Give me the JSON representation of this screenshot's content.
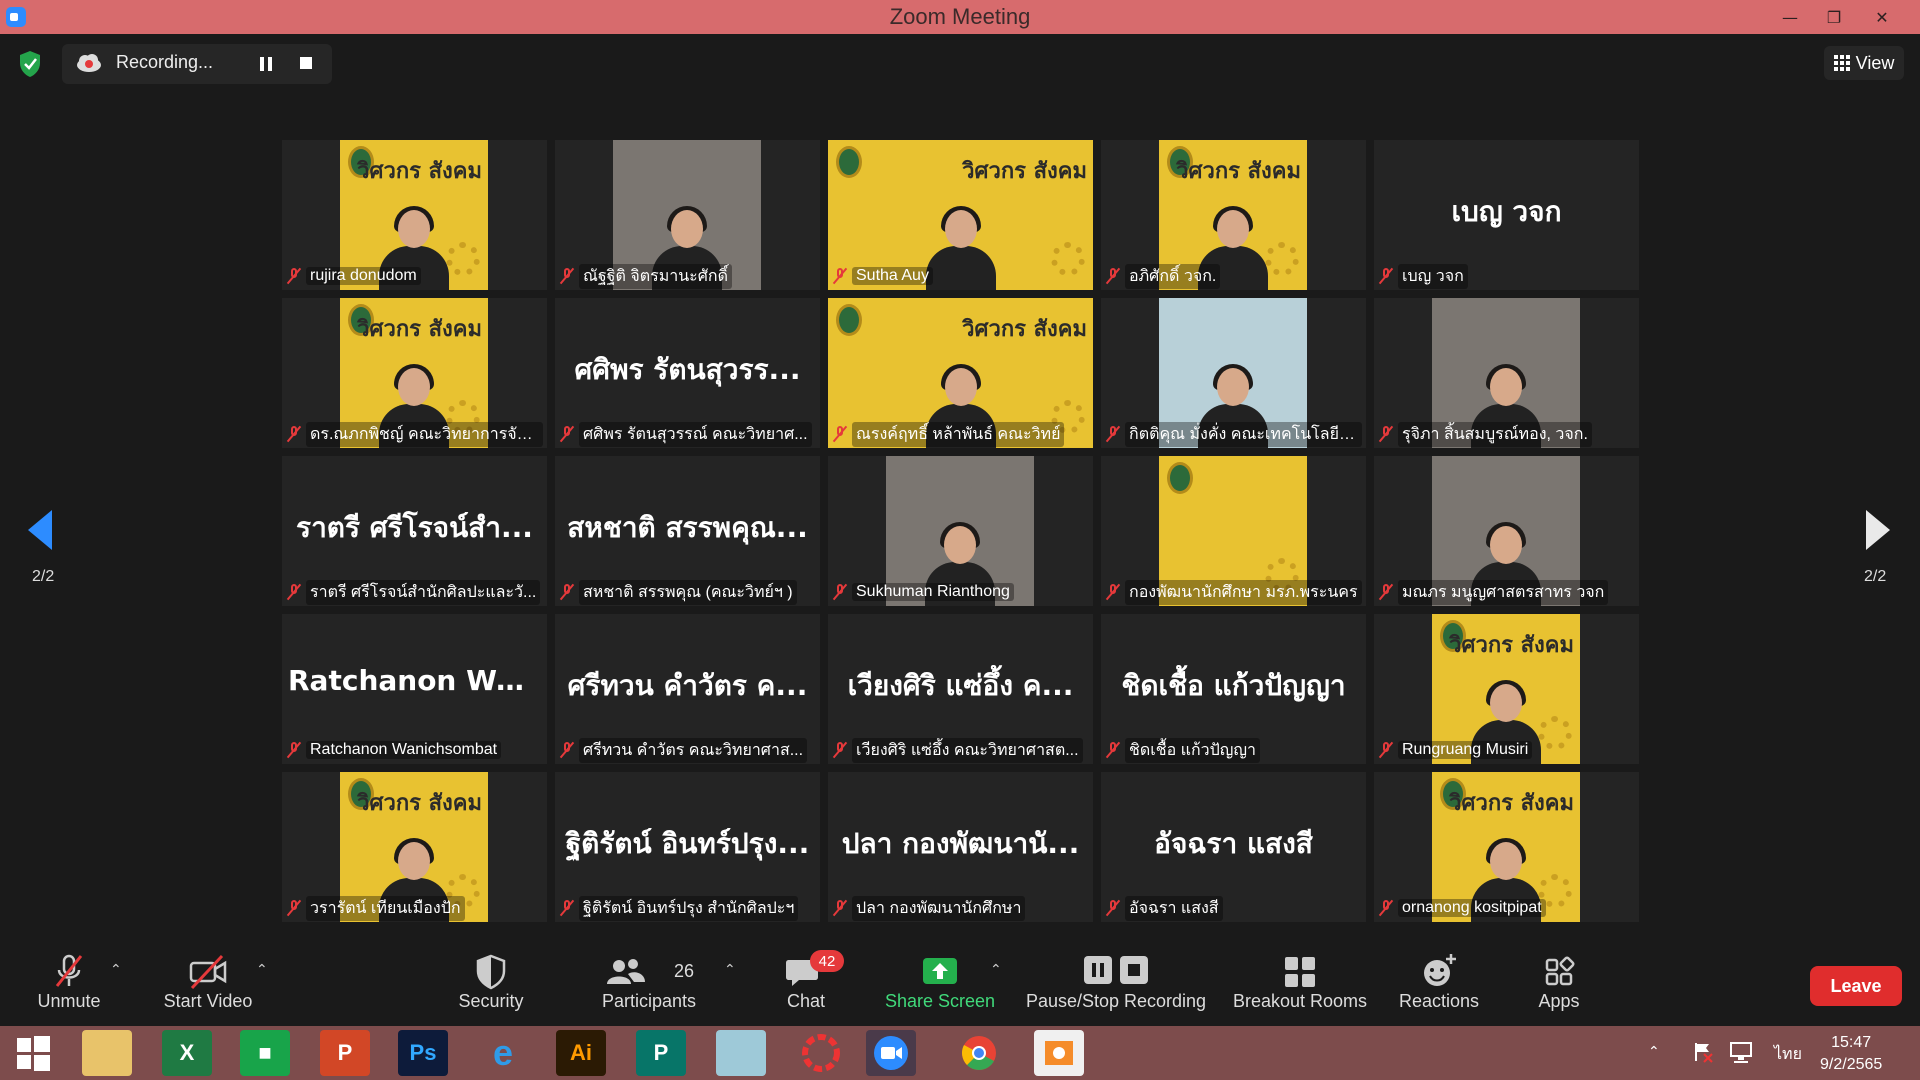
{
  "window": {
    "title": "Zoom Meeting"
  },
  "recording": {
    "status": "Recording..."
  },
  "view": {
    "label": "View"
  },
  "pagination": {
    "left": "2/2",
    "right": "2/2"
  },
  "tiles": [
    {
      "name": "rujira donudom",
      "kind": "poster"
    },
    {
      "name": "ณัฐฐิติ จิตรมานะศักดิ์",
      "kind": "cam"
    },
    {
      "name": "Sutha Auy",
      "kind": "posterfull"
    },
    {
      "name": "อภิศักดิ์ วจก.",
      "kind": "poster"
    },
    {
      "name": "เบญ วจก",
      "kind": "text",
      "display": "เบญ วจก"
    },
    {
      "name": "ดร.ณภกพิชญ์ คณะวิทยาการจัด...",
      "kind": "poster"
    },
    {
      "name": "ศศิพร รัตนสุวรรณ์ คณะวิทยาศ...",
      "kind": "text",
      "display": "ศศิพร รัตนสุวรร..."
    },
    {
      "name": "ณรงค์ฤทธิ์ หล้าพันธ์ คณะวิทย์",
      "kind": "posterfull",
      "active": true
    },
    {
      "name": "กิตติคุณ มั่งคั่ง คณะเทคโนโลยีอุ...",
      "kind": "cartoon"
    },
    {
      "name": "รุจิภา สิ้นสมบูรณ์ทอง, วจก.",
      "kind": "cam"
    },
    {
      "name": "ราตรี ศรีโรจน์สำนักศิลปะและวั...",
      "kind": "text",
      "display": "ราตรี ศรีโรจน์สำ..."
    },
    {
      "name": "สหชาติ สรรพคุณ (คณะวิทย์ฯ )",
      "kind": "text",
      "display": "สหชาติ สรรพคุณ..."
    },
    {
      "name": "Sukhuman Rianthong",
      "kind": "cam"
    },
    {
      "name": "กองพัฒนานักศึกษา มรภ.พระนคร",
      "kind": "uni"
    },
    {
      "name": "มณภร มนูญศาสตรสาทร วจก",
      "kind": "cam"
    },
    {
      "name": "Ratchanon Wanichsombat",
      "kind": "text",
      "display": "Ratchanon Wan..."
    },
    {
      "name": "ศรีทวน คำวัตร คณะวิทยาศาส...",
      "kind": "text",
      "display": "ศรีทวน คำวัตร ค..."
    },
    {
      "name": "เวียงศิริ แซ่อึ้ง คณะวิทยาศาสต...",
      "kind": "text",
      "display": "เวียงศิริ แซ่อึ้ง ค..."
    },
    {
      "name": "ชิดเชื้อ แก้วปัญญา",
      "kind": "text",
      "display": "ชิดเชื้อ แก้วปัญญา"
    },
    {
      "name": "Rungruang Musiri",
      "kind": "poster"
    },
    {
      "name": "วรารัตน์ เทียนเมืองปัก",
      "kind": "poster"
    },
    {
      "name": "ฐิติรัตน์ อินทร์ปรุง สำนักศิลปะฯ",
      "kind": "text",
      "display": "ฐิติรัตน์ อินทร์ปรุง..."
    },
    {
      "name": "ปลา กองพัฒนานักศึกษา",
      "kind": "text",
      "display": "ปลา กองพัฒนานั..."
    },
    {
      "name": "อัจฉรา แสงสี",
      "kind": "text",
      "display": "อัจฉรา แสงสี"
    },
    {
      "name": "ornanong kositpipat",
      "kind": "poster"
    }
  ],
  "poster_text": "วิศวกร สังคม",
  "toolbar": {
    "unmute": "Unmute",
    "start_video": "Start Video",
    "security": "Security",
    "participants": "Participants",
    "participants_count": "26",
    "chat": "Chat",
    "chat_badge": "42",
    "share_screen": "Share Screen",
    "pause_stop_recording": "Pause/Stop Recording",
    "breakout_rooms": "Breakout Rooms",
    "reactions": "Reactions",
    "apps": "Apps",
    "leave": "Leave"
  },
  "taskbar": {
    "apps": [
      "Windows Start",
      "File Explorer",
      "Excel",
      "Store",
      "PowerPoint",
      "Photoshop",
      "Internet Explorer",
      "Illustrator",
      "Publisher",
      "Notepad",
      "Photoscape",
      "Zoom",
      "Chrome",
      "Photo Viewer"
    ],
    "language": "ไทย",
    "time": "15:47",
    "date": "9/2/2565"
  },
  "colors": {
    "titlebar": "#d76b6d",
    "leave": "#e02d2d",
    "active_speaker": "#e7ea5b",
    "poster": "#e8c231",
    "share": "#40d97a"
  }
}
